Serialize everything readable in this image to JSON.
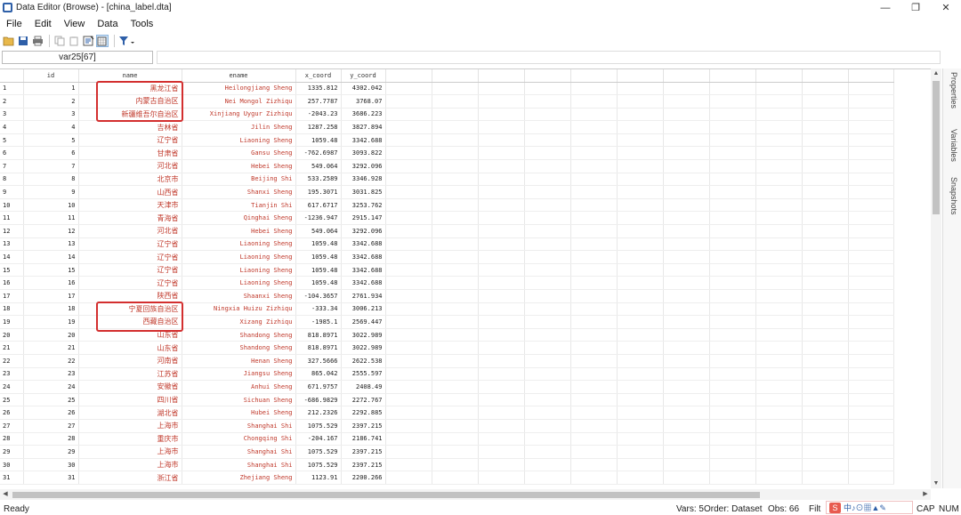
{
  "window": {
    "title": "Data Editor (Browse) - [china_label.dta]",
    "controls": [
      "—",
      "❐",
      "✕"
    ]
  },
  "menu": [
    "File",
    "Edit",
    "View",
    "Data",
    "Tools"
  ],
  "toolbar": {
    "icons": [
      "open-icon",
      "save-icon",
      "print-icon",
      "copy-icon",
      "paste-icon",
      "variables-manager-icon",
      "data-editor-edit-icon",
      "filter-icon"
    ]
  },
  "cellbar": {
    "name": "var25[67]",
    "value": ""
  },
  "grid": {
    "columns": [
      "id",
      "name",
      "ename",
      "x_coord",
      "y_coord"
    ],
    "rows": [
      {
        "n": "1",
        "id": "1",
        "name": "黑龙江省",
        "ename": "Heilongjiang Sheng",
        "x": "1335.812",
        "y": "4302.042"
      },
      {
        "n": "2",
        "id": "2",
        "name": "内蒙古自治区",
        "ename": "Nei Mongol Zizhiqu",
        "x": "257.7787",
        "y": "3768.07"
      },
      {
        "n": "3",
        "id": "3",
        "name": "新疆维吾尔自治区",
        "ename": "Xinjiang Uygur Zizhiqu",
        "x": "-2043.23",
        "y": "3686.223"
      },
      {
        "n": "4",
        "id": "4",
        "name": "吉林省",
        "ename": "Jilin Sheng",
        "x": "1287.258",
        "y": "3827.894"
      },
      {
        "n": "5",
        "id": "5",
        "name": "辽宁省",
        "ename": "Liaoning Sheng",
        "x": "1059.48",
        "y": "3342.688"
      },
      {
        "n": "6",
        "id": "6",
        "name": "甘肃省",
        "ename": "Gansu Sheng",
        "x": "-762.6987",
        "y": "3093.822"
      },
      {
        "n": "7",
        "id": "7",
        "name": "河北省",
        "ename": "Hebei Sheng",
        "x": "549.064",
        "y": "3292.096"
      },
      {
        "n": "8",
        "id": "8",
        "name": "北京市",
        "ename": "Beijing Shi",
        "x": "533.2589",
        "y": "3346.928"
      },
      {
        "n": "9",
        "id": "9",
        "name": "山西省",
        "ename": "Shanxi Sheng",
        "x": "195.3071",
        "y": "3031.825"
      },
      {
        "n": "10",
        "id": "10",
        "name": "天津市",
        "ename": "Tianjin Shi",
        "x": "617.6717",
        "y": "3253.762"
      },
      {
        "n": "11",
        "id": "11",
        "name": "青海省",
        "ename": "Qinghai Sheng",
        "x": "-1236.947",
        "y": "2915.147"
      },
      {
        "n": "12",
        "id": "12",
        "name": "河北省",
        "ename": "Hebei Sheng",
        "x": "549.064",
        "y": "3292.096"
      },
      {
        "n": "13",
        "id": "13",
        "name": "辽宁省",
        "ename": "Liaoning Sheng",
        "x": "1059.48",
        "y": "3342.688"
      },
      {
        "n": "14",
        "id": "14",
        "name": "辽宁省",
        "ename": "Liaoning Sheng",
        "x": "1059.48",
        "y": "3342.688"
      },
      {
        "n": "15",
        "id": "15",
        "name": "辽宁省",
        "ename": "Liaoning Sheng",
        "x": "1059.48",
        "y": "3342.688"
      },
      {
        "n": "16",
        "id": "16",
        "name": "辽宁省",
        "ename": "Liaoning Sheng",
        "x": "1059.48",
        "y": "3342.688"
      },
      {
        "n": "17",
        "id": "17",
        "name": "陕西省",
        "ename": "Shaanxi Sheng",
        "x": "-104.3657",
        "y": "2761.934"
      },
      {
        "n": "18",
        "id": "18",
        "name": "宁夏回族自治区",
        "ename": "Ningxia Huizu Zizhiqu",
        "x": "-333.34",
        "y": "3006.213"
      },
      {
        "n": "19",
        "id": "19",
        "name": "西藏自治区",
        "ename": "Xizang Zizhiqu",
        "x": "-1985.1",
        "y": "2569.447"
      },
      {
        "n": "20",
        "id": "20",
        "name": "山东省",
        "ename": "Shandong Sheng",
        "x": "818.8971",
        "y": "3022.989"
      },
      {
        "n": "21",
        "id": "21",
        "name": "山东省",
        "ename": "Shandong Sheng",
        "x": "818.8971",
        "y": "3022.989"
      },
      {
        "n": "22",
        "id": "22",
        "name": "河南省",
        "ename": "Henan Sheng",
        "x": "327.5666",
        "y": "2622.538"
      },
      {
        "n": "23",
        "id": "23",
        "name": "江苏省",
        "ename": "Jiangsu Sheng",
        "x": "865.042",
        "y": "2555.597"
      },
      {
        "n": "24",
        "id": "24",
        "name": "安徽省",
        "ename": "Anhui Sheng",
        "x": "671.9757",
        "y": "2408.49"
      },
      {
        "n": "25",
        "id": "25",
        "name": "四川省",
        "ename": "Sichuan Sheng",
        "x": "-686.9829",
        "y": "2272.767"
      },
      {
        "n": "26",
        "id": "26",
        "name": "湖北省",
        "ename": "Hubei Sheng",
        "x": "212.2326",
        "y": "2292.885"
      },
      {
        "n": "27",
        "id": "27",
        "name": "上海市",
        "ename": "Shanghai Shi",
        "x": "1075.529",
        "y": "2397.215"
      },
      {
        "n": "28",
        "id": "28",
        "name": "重庆市",
        "ename": "Chongqing Shi",
        "x": "-204.167",
        "y": "2186.741"
      },
      {
        "n": "29",
        "id": "29",
        "name": "上海市",
        "ename": "Shanghai Shi",
        "x": "1075.529",
        "y": "2397.215"
      },
      {
        "n": "30",
        "id": "30",
        "name": "上海市",
        "ename": "Shanghai Shi",
        "x": "1075.529",
        "y": "2397.215"
      },
      {
        "n": "31",
        "id": "31",
        "name": "浙江省",
        "ename": "Zhejiang Sheng",
        "x": "1123.91",
        "y": "2200.266"
      }
    ]
  },
  "side_tabs": [
    "Properties",
    "Variables",
    "Snapshots"
  ],
  "status": {
    "left": "Ready",
    "vars": "Vars: 5",
    "order": "Order: Dataset",
    "obs": "Obs: 66",
    "filter": "Filt",
    "cap": "CAP",
    "num": "NUM"
  },
  "ime": {
    "logo": "S",
    "text": "中♪⊙▦▲✎"
  },
  "colors": {
    "value_label": "#c0392b",
    "highlight_box": "#d32f2f"
  }
}
